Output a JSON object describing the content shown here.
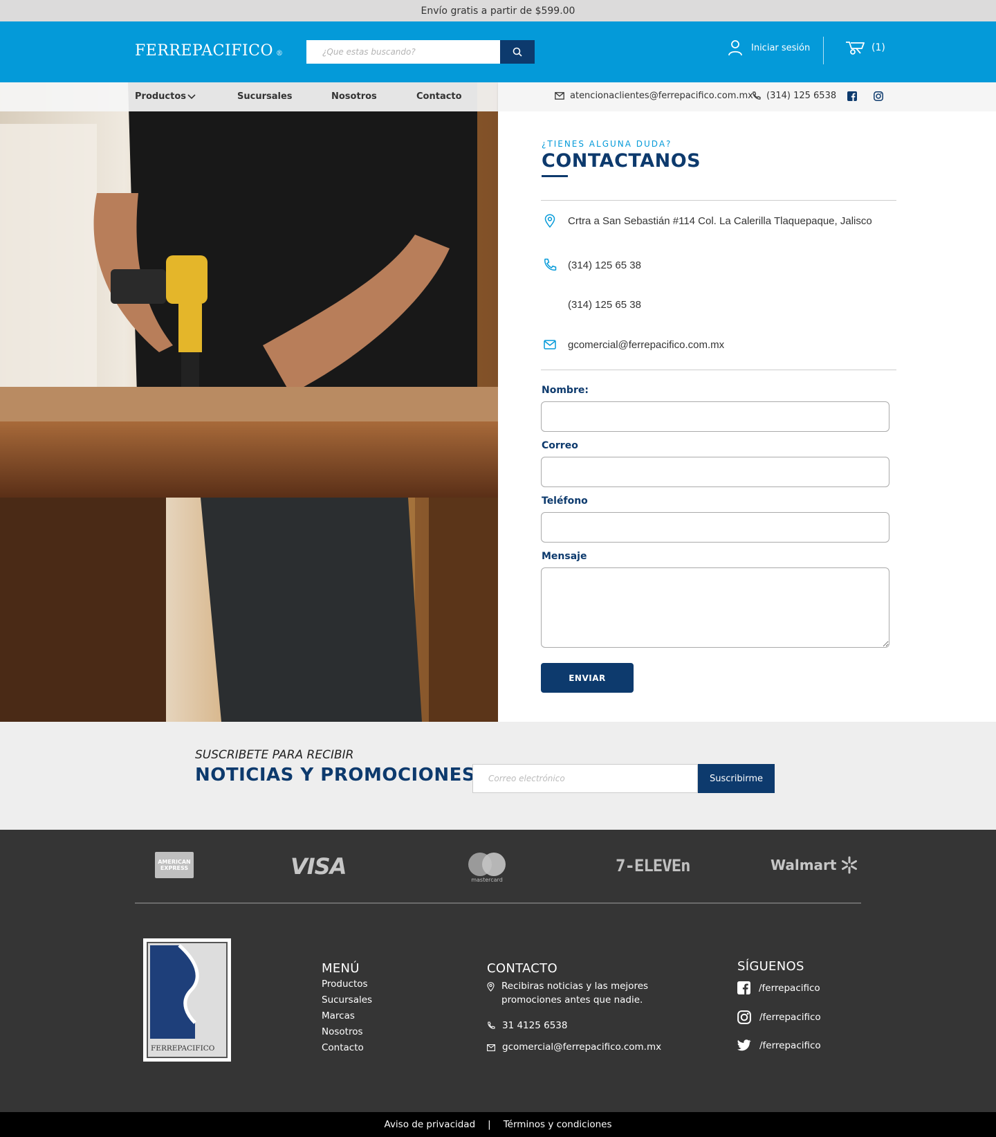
{
  "topbar": {
    "promo": "Envío gratis a partir de $599.00"
  },
  "header": {
    "logo": "FERREPACIFICO",
    "logo_mark": "®",
    "search_placeholder": "¿Que estas buscando?",
    "login_label": "Iniciar sesión",
    "cart_count": "(1)"
  },
  "nav": {
    "items": [
      {
        "label": "Productos"
      },
      {
        "label": "Sucursales"
      },
      {
        "label": "Nosotros"
      },
      {
        "label": "Contacto"
      }
    ],
    "email": "atencionaclientes@ferrepacifico.com.mx",
    "phone": "(314) 125 6538"
  },
  "contact": {
    "eyebrow": "¿TIENES ALGUNA DUDA?",
    "title": "CONTACTANOS",
    "address": "Crtra a San Sebastián #114 Col. La Calerilla Tlaquepaque, Jalisco",
    "phone1": "(314) 125 65 38",
    "phone2": "(314) 125 65 38",
    "email": "gcomercial@ferrepacifico.com.mx",
    "form": {
      "name_label": "Nombre:",
      "email_label": "Correo",
      "phone_label": "Teléfono",
      "message_label": "Mensaje",
      "submit_label": "ENVIAR"
    }
  },
  "subscribe": {
    "small": "SUSCRIBETE PARA RECIBIR",
    "big": "NOTICIAS Y PROMOCIONES",
    "placeholder": "Correo electrónico",
    "button": "Suscribirme"
  },
  "payments": {
    "amex_line1": "AMERICAN",
    "amex_line2": "EXPRESS",
    "visa": "VISA",
    "mastercard": "mastercard",
    "seven_eleven": "7-ELEVEn",
    "walmart": "Walmart"
  },
  "footer": {
    "logo_text": "FERREPACIFICO",
    "menu_title": "MENÚ",
    "menu_items": [
      "Productos",
      "Sucursales",
      "Marcas",
      "Nosotros",
      "Contacto"
    ],
    "contact_title": "CONTACTO",
    "contact_note_line1": "Recibiras noticias y las mejores",
    "contact_note_line2": "promociones antes que nadie.",
    "contact_phone": "31 4125 6538",
    "contact_email": "gcomercial@ferrepacifico.com.mx",
    "follow_title": "SÍGUENOS",
    "facebook": "/ferrepacifico",
    "instagram": "/ferrepacifico",
    "twitter": "/ferrepacifico"
  },
  "bottom": {
    "privacy": "Aviso de privacidad",
    "separator": "|",
    "terms": "Términos y condiciones"
  },
  "colors": {
    "brand_blue": "#049ad9",
    "navy": "#0d3a6d",
    "footer_bg": "#353535"
  }
}
